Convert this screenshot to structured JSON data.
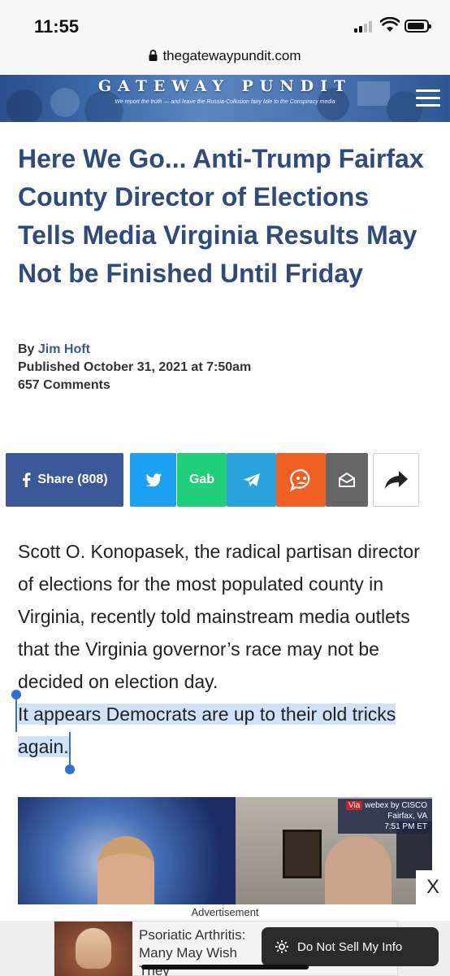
{
  "status": {
    "time": "11:55"
  },
  "browser": {
    "url": "thegatewaypundit.com"
  },
  "site": {
    "brand": "GATEWAY PUNDIT",
    "tagline": "We report the truth — and leave the Russia-Collusion fairy tale to the Conspiracy media"
  },
  "article": {
    "headline": "Here We Go... Anti-Trump Fairfax County Director of Elections Tells Media Virginia Results May Not be Finished Until Friday",
    "by_prefix": "By",
    "author": "Jim Hoft",
    "published": "Published October 31, 2021 at 7:50am",
    "comments": "657 Comments",
    "paragraph1": "Scott O. Konopasek, the radical partisan director of elections for the most populated county in Virginia, recently told mainstream media outlets that the Virginia governor’s race may not be decided on election day.",
    "paragraph2": "It appears Democrats are up to their old tricks again."
  },
  "share": {
    "facebook_label": "Share",
    "facebook_count": "(808)",
    "gab_label": "Gab"
  },
  "video": {
    "via": "Via",
    "source": "webex by CISCO",
    "location": "Fairfax, VA",
    "time": "7:51 PM ET"
  },
  "ad": {
    "label": "Advertisement",
    "text": "Psoriatic Arthritis: Many May Wish They",
    "close": "X",
    "do_not_sell": "Do Not Sell My Info"
  },
  "colors": {
    "headline": "#2f4b7c",
    "facebook": "#3b5998",
    "twitter": "#1da1f2",
    "gab": "#21cf7a",
    "telegram": "#2aa3dc",
    "mewe": "#f25f22",
    "email": "#666666",
    "selection": "#cfe2f9"
  },
  "icons": [
    "signal-icon",
    "wifi-icon",
    "battery-icon",
    "lock-icon",
    "menu-icon",
    "facebook-icon",
    "twitter-icon",
    "telegram-icon",
    "mewe-icon",
    "email-icon",
    "share-arrow-icon",
    "gear-icon",
    "close-icon"
  ]
}
